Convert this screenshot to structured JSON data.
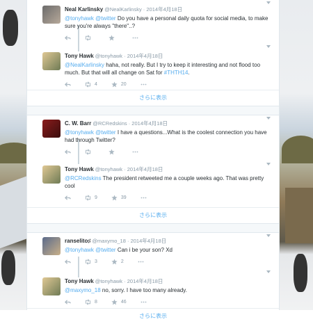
{
  "conversations": [
    {
      "tweets": [
        {
          "name": "Neal Karlinsky",
          "handle": "@NealKarlinsky",
          "date": "· 2014年4月18日",
          "mentions": "@tonyhawk @twitter",
          "text": " Do you have a personal daily quota for social media, to make sure you're always \"there\"..?",
          "retweets": "",
          "favorites": ""
        },
        {
          "name": "Tony Hawk",
          "handle": "@tonyhawk",
          "date": "· 2014年4月18日",
          "mentions": "@NealKarlinsky",
          "text": " haha, not really. But I try to keep it interesting and not flood too much. But that will all change on Sat for ",
          "hashtag": "#THTH14",
          "text_end": ".",
          "retweets": "4",
          "favorites": "20"
        }
      ],
      "more_label": "さらに表示"
    },
    {
      "tweets": [
        {
          "name": "C. W. Barr",
          "handle": "@RCRedskins",
          "date": "· 2014年4月18日",
          "mentions": "@tonyhawk @twitter",
          "text": " I have a questions...What is the coolest connection you have had through Twitter?",
          "retweets": "",
          "favorites": ""
        },
        {
          "name": "Tony Hawk",
          "handle": "@tonyhawk",
          "date": "· 2014年4月18日",
          "mentions": "@RCRedskins",
          "text": " The president retweeted me a couple weeks ago. That was pretty cool",
          "retweets": "9",
          "favorites": "39"
        }
      ],
      "more_label": "さらに表示"
    },
    {
      "tweets": [
        {
          "name": "ranselito♯",
          "handle": "@maxymo_18",
          "date": "· 2014年4月18日",
          "mentions": "@tonyhawk @twitter",
          "text": " Can i be your son? Xd",
          "retweets": "3",
          "favorites": "2"
        },
        {
          "name": "Tony Hawk",
          "handle": "@tonyhawk",
          "date": "· 2014年4月18日",
          "mentions": "@maxymo_18",
          "text": " no, sorry. I have too many already.",
          "retweets": "8",
          "favorites": "46"
        }
      ],
      "more_label": "さらに表示"
    }
  ],
  "colors": {
    "link": "#55acee",
    "muted": "#8899a6",
    "text": "#292f33"
  },
  "icons": [
    "reply-icon",
    "retweet-icon",
    "favorite-icon",
    "more-icon",
    "caret-down-icon"
  ]
}
